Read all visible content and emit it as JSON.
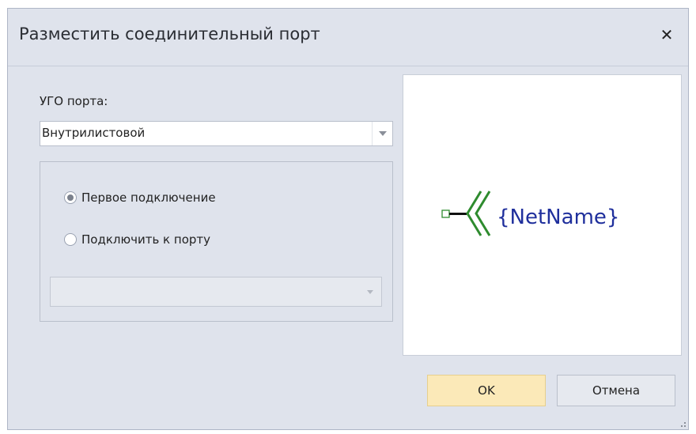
{
  "dialog": {
    "title": "Разместить соединительный порт",
    "close_glyph": "✕"
  },
  "form": {
    "ugo_label": "УГО порта:",
    "ugo_value": "Внутрилистовой",
    "radio_first_label": "Первое подключение",
    "radio_first_checked": true,
    "radio_connect_label": "Подключить к порту",
    "radio_connect_checked": false,
    "port_combo_value": ""
  },
  "preview": {
    "net_name": "{NetName}",
    "symbol_color": "#2e8b2e",
    "text_color": "#1f2f9c"
  },
  "buttons": {
    "ok_label": "OK",
    "cancel_label": "Отмена"
  },
  "colors": {
    "dialog_bg": "#dfe3ec",
    "ok_bg": "#fbe9b8"
  }
}
